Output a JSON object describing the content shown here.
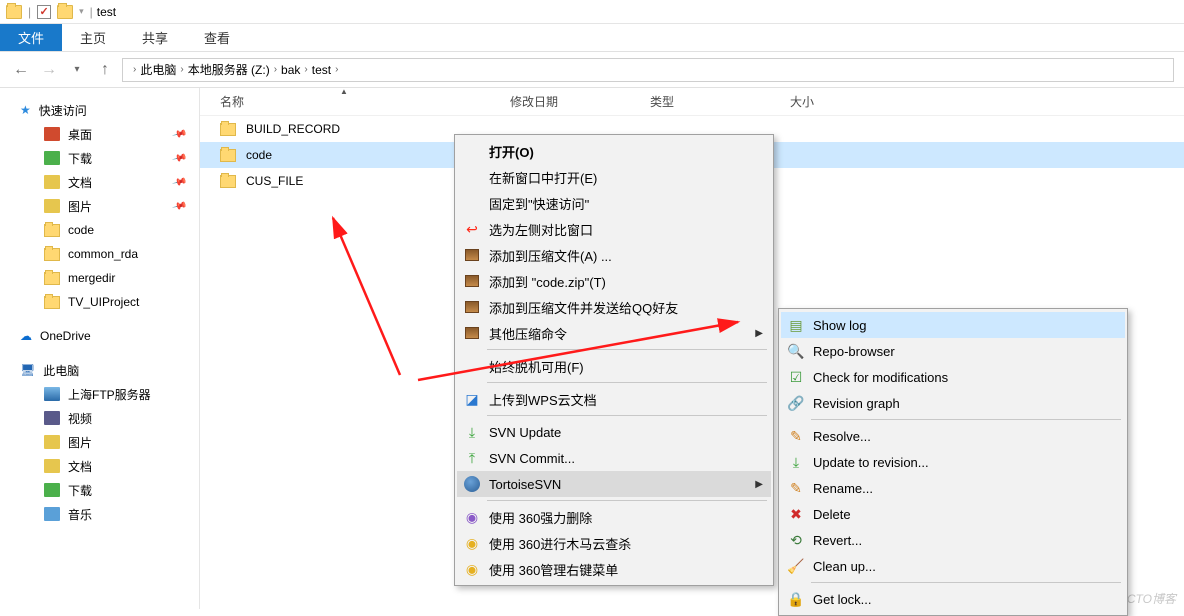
{
  "titlebar": {
    "title": "test"
  },
  "ribbon": {
    "file": "文件",
    "home": "主页",
    "share": "共享",
    "view": "查看"
  },
  "breadcrumb": {
    "root": "此电脑",
    "drive": "本地服务器 (Z:)",
    "folder1": "bak",
    "folder2": "test"
  },
  "sidebar": {
    "quick_access": "快速访问",
    "desktop": "桌面",
    "downloads": "下载",
    "documents": "文档",
    "pictures": "图片",
    "code": "code",
    "common_rda": "common_rda",
    "mergedir": "mergedir",
    "tv_uiproject": "TV_UIProject",
    "onedrive": "OneDrive",
    "this_pc": "此电脑",
    "shanghai_ftp": "上海FTP服务器",
    "videos": "视频",
    "pictures2": "图片",
    "documents2": "文档",
    "downloads2": "下载",
    "music": "音乐"
  },
  "columns": {
    "name": "名称",
    "date": "修改日期",
    "type": "类型",
    "size": "大小"
  },
  "files": {
    "build_record": "BUILD_RECORD",
    "code": "code",
    "cus_file": "CUS_FILE"
  },
  "context_menu": {
    "open": "打开(O)",
    "open_new_window": "在新窗口中打开(E)",
    "pin_quick_access": "固定到\"快速访问\"",
    "compare_left": "选为左侧对比窗口",
    "add_archive": "添加到压缩文件(A) ...",
    "add_codezip": "添加到 \"code.zip\"(T)",
    "add_send_qq": "添加到压缩文件并发送给QQ好友",
    "other_compress": "其他压缩命令",
    "offline_available": "始终脱机可用(F)",
    "upload_wps": "上传到WPS云文档",
    "svn_update": "SVN Update",
    "svn_commit": "SVN Commit...",
    "tortoise_svn": "TortoiseSVN",
    "use360_force": "使用 360强力删除",
    "use360_trojan": "使用 360进行木马云查杀",
    "use360_menu": "使用 360管理右键菜单"
  },
  "submenu": {
    "show_log": "Show log",
    "repo_browser": "Repo-browser",
    "check_modifications": "Check for modifications",
    "revision_graph": "Revision graph",
    "resolve": "Resolve...",
    "update_revision": "Update to revision...",
    "rename": "Rename...",
    "delete": "Delete",
    "revert": "Revert...",
    "cleanup": "Clean up...",
    "get_lock": "Get lock..."
  },
  "watermark": "51CTO博客"
}
